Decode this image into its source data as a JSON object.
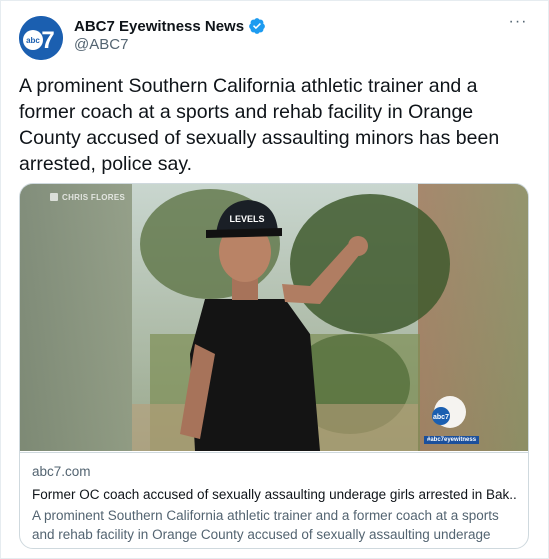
{
  "account": {
    "name": "ABC7 Eyewitness News",
    "handle": "@ABC7",
    "verified_icon": "verified-badge-icon",
    "avatar_text": "abc7"
  },
  "more_label": "···",
  "tweet": {
    "text": "A prominent Southern California athletic trainer and a former coach at a sports and rehab facility in Orange County accused of sexually assaulting minors has been arrested, police say."
  },
  "card": {
    "photo_credit": "CHRIS FLORES",
    "cap_text": "LEVELS",
    "watermark_logo": "abc7",
    "watermark_hashtag": "#abc7eyewitness",
    "domain": "abc7.com",
    "title": "Former OC coach accused of sexually assaulting underage girls arrested in Bak...",
    "description": "A prominent Southern California athletic trainer and a former coach at a sports and rehab facility in Orange County accused of sexually assaulting underage gi..."
  },
  "colors": {
    "text_primary": "#0f1419",
    "text_secondary": "#536471",
    "border": "#cfd9de",
    "verified": "#1d9bf0",
    "abc_blue": "#1b5fb0"
  }
}
